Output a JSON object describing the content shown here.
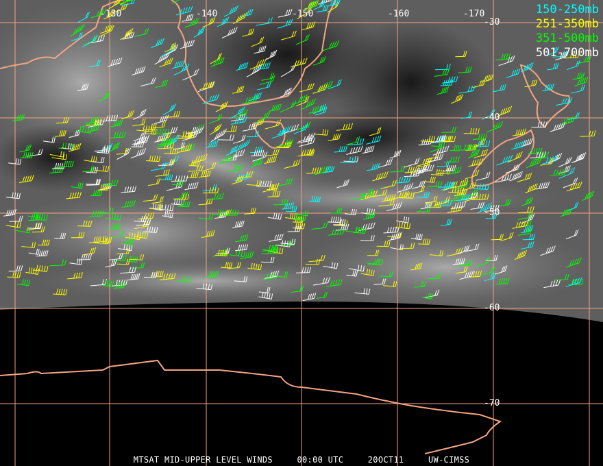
{
  "legend": [
    {
      "label": "150-250mb",
      "color": "#00ffff"
    },
    {
      "label": "251-350mb",
      "color": "#ffff00"
    },
    {
      "label": "351-500mb",
      "color": "#00ff00"
    },
    {
      "label": "501-700mb",
      "color": "#ffffff"
    }
  ],
  "longitude_labels": [
    "-130",
    "-140",
    "-150",
    "-160",
    "-170"
  ],
  "latitude_labels": [
    "-30",
    "-40",
    "-50",
    "-60",
    "-70"
  ],
  "footer": {
    "product": "MTSAT MID-UPPER LEVEL WINDS",
    "time": "00:00 UTC",
    "date": "20OCT11",
    "source": "UW-CIMSS"
  },
  "colors": {
    "grid": "#f4a582",
    "coast": "#f4a582",
    "background": "#000000"
  }
}
